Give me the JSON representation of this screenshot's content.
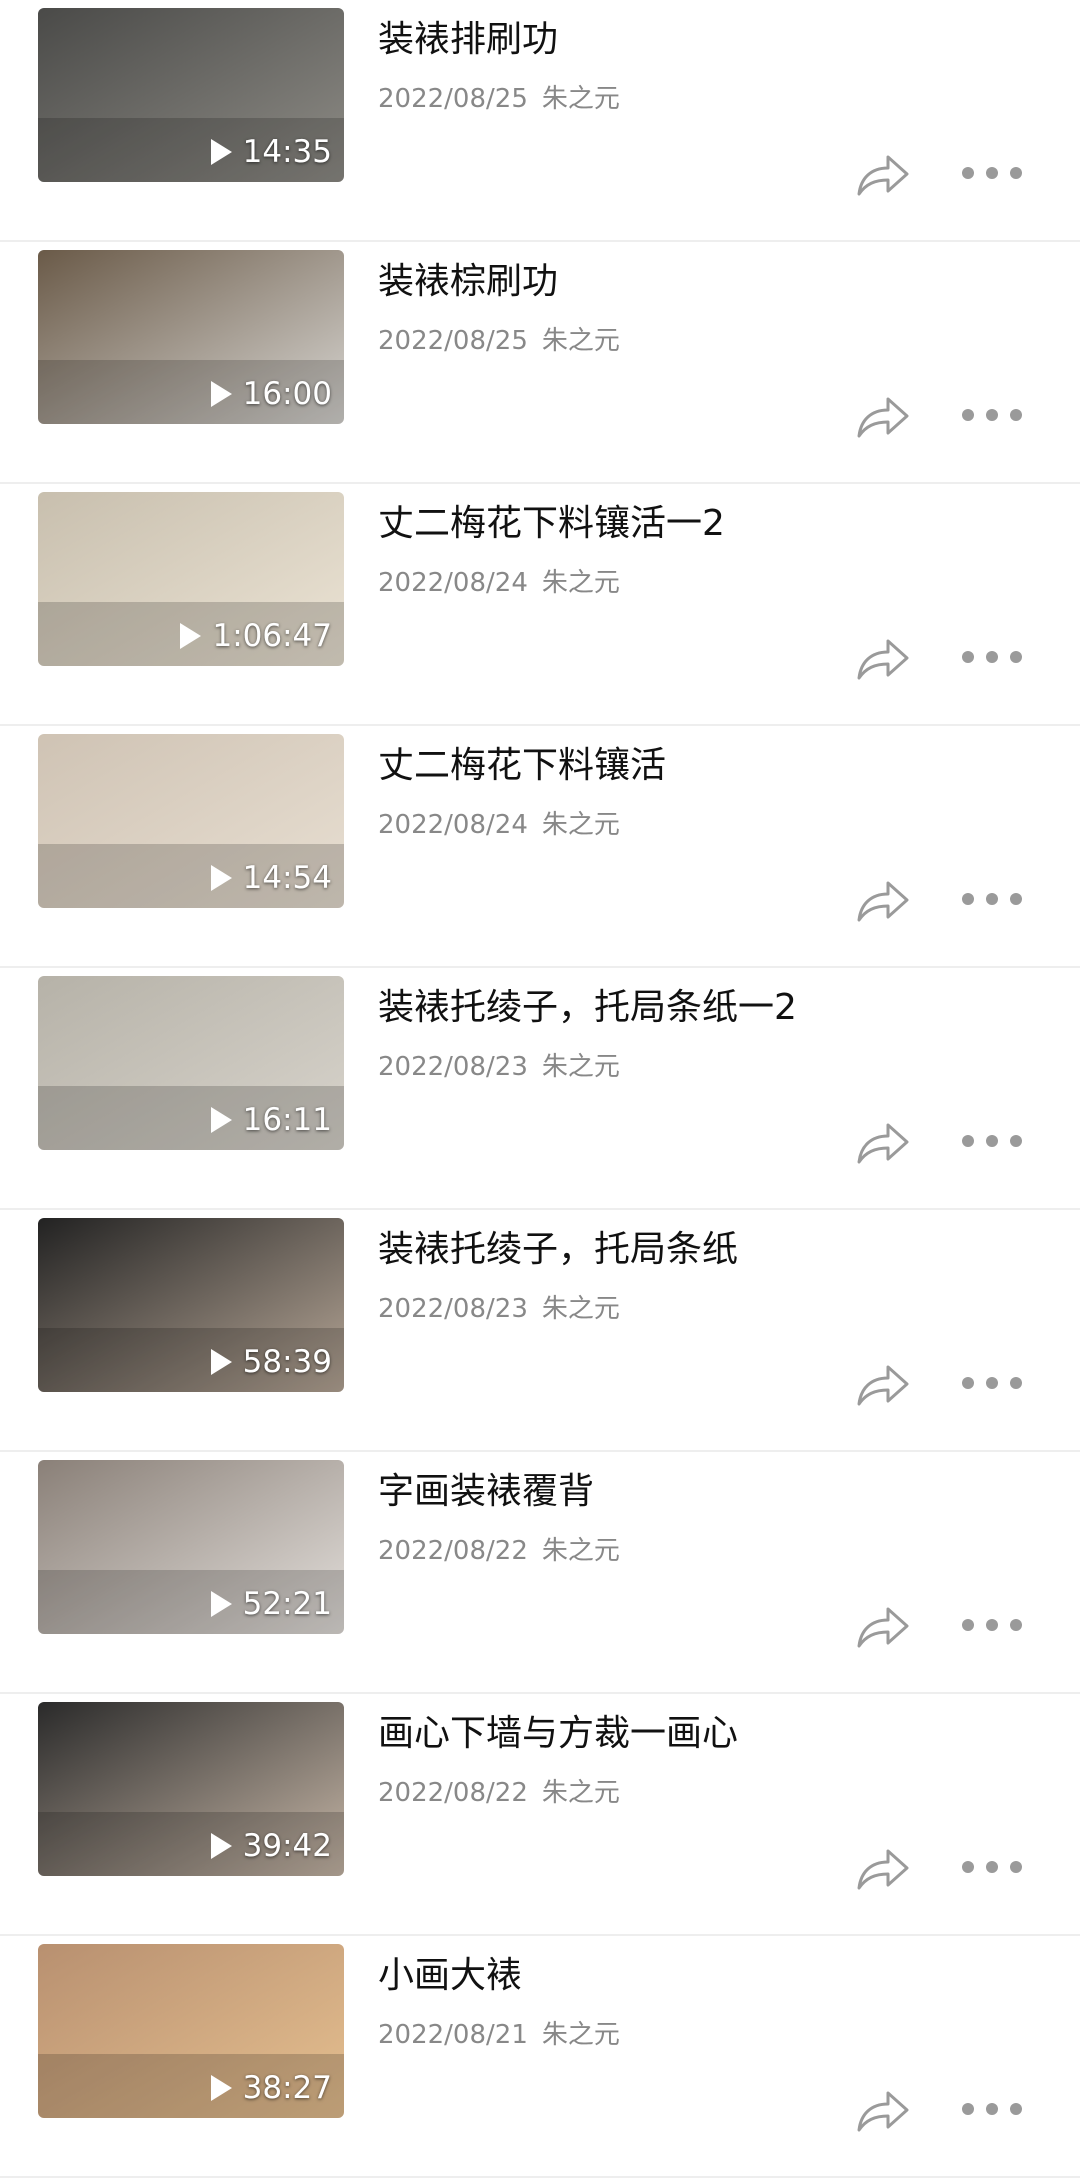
{
  "videos": [
    {
      "title": "装裱排刷功",
      "date": "2022/08/25",
      "author": "朱之元",
      "duration": "14:35",
      "thumb_colors": [
        "#4a4a48",
        "#8f8d87"
      ]
    },
    {
      "title": "装裱棕刷功",
      "date": "2022/08/25",
      "author": "朱之元",
      "duration": "16:00",
      "thumb_colors": [
        "#6a5a48",
        "#d8d6d2"
      ]
    },
    {
      "title": "丈二梅花下料镶活一2",
      "date": "2022/08/24",
      "author": "朱之元",
      "duration": "1:06:47",
      "thumb_colors": [
        "#c8bfae",
        "#ece4d5"
      ]
    },
    {
      "title": "丈二梅花下料镶活",
      "date": "2022/08/24",
      "author": "朱之元",
      "duration": "14:54",
      "thumb_colors": [
        "#cfc3b4",
        "#e8dfd2"
      ]
    },
    {
      "title": "装裱托绫子，托局条纸一2",
      "date": "2022/08/23",
      "author": "朱之元",
      "duration": "16:11",
      "thumb_colors": [
        "#b6b2a8",
        "#d8d4cc"
      ]
    },
    {
      "title": "装裱托绫子，托局条纸",
      "date": "2022/08/23",
      "author": "朱之元",
      "duration": "58:39",
      "thumb_colors": [
        "#222222",
        "#b8a898"
      ]
    },
    {
      "title": "字画装裱覆背",
      "date": "2022/08/22",
      "author": "朱之元",
      "duration": "52:21",
      "thumb_colors": [
        "#8a8078",
        "#e4e0dc"
      ]
    },
    {
      "title": "画心下墙与方裁一画心",
      "date": "2022/08/22",
      "author": "朱之元",
      "duration": "39:42",
      "thumb_colors": [
        "#2a2a2a",
        "#c8b8a8"
      ]
    },
    {
      "title": "小画大裱",
      "date": "2022/08/21",
      "author": "朱之元",
      "duration": "38:27",
      "thumb_colors": [
        "#b89070",
        "#e6c090"
      ]
    }
  ],
  "icons": {
    "play": "play-icon",
    "share": "share-icon",
    "more": "more-icon"
  }
}
